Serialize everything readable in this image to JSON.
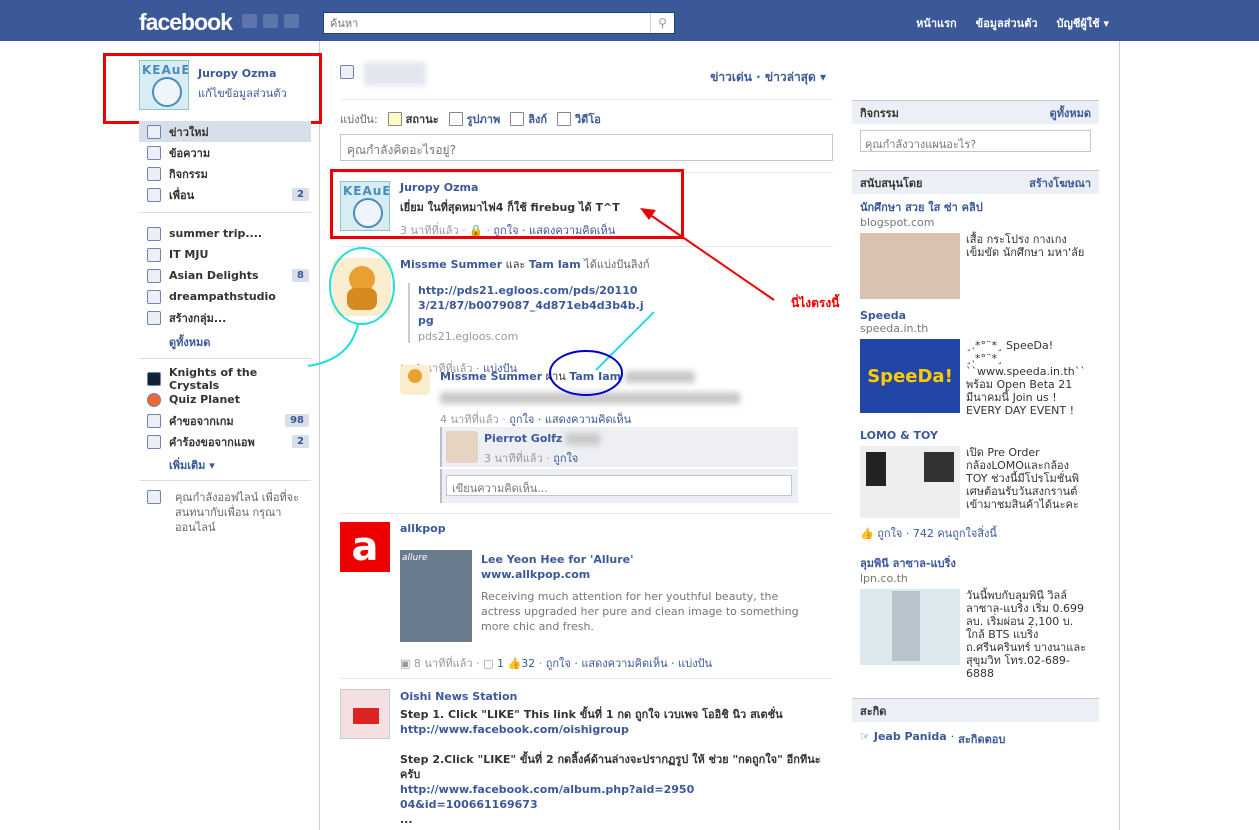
{
  "topbar": {
    "logo": "facebook",
    "search_placeholder": "ค้นหา",
    "nav": [
      "หน้าแรก",
      "ข้อมูลส่วนตัว",
      "บัญชีผู้ใช้ ▾"
    ]
  },
  "profile": {
    "name": "Juropy Ozma",
    "edit": "แก้ไขข้อมูลส่วนตัว",
    "avatar_text": "KEAuE"
  },
  "nav_main": [
    {
      "label": "ข่าวใหม่",
      "badge": "",
      "selected": true
    },
    {
      "label": "ข้อความ",
      "badge": ""
    },
    {
      "label": "กิจกรรม",
      "badge": ""
    },
    {
      "label": "เพื่อน",
      "badge": "2"
    }
  ],
  "nav_groups": [
    {
      "label": "summer trip....",
      "badge": ""
    },
    {
      "label": "IT MJU",
      "badge": ""
    },
    {
      "label": "Asian Delights",
      "badge": "8"
    },
    {
      "label": "dreampathstudio",
      "badge": ""
    },
    {
      "label": "สร้างกลุ่ม...",
      "badge": ""
    }
  ],
  "nav_groups_more": "ดูทั้งหมด",
  "nav_apps": [
    {
      "label": "Knights of the Crystals",
      "badge": ""
    },
    {
      "label": "Quiz Planet",
      "badge": ""
    },
    {
      "label": "คำขอจากเกม",
      "badge": "98"
    },
    {
      "label": "คำร้องขอจากแอพ",
      "badge": "2"
    }
  ],
  "nav_apps_more": "เพิ่มเติม ▾",
  "chat_status": "คุณกำลังออฟไลน์ เพื่อที่จะสนทนากับเพื่อน กรุณาออนไลน์",
  "feed": {
    "sort": "ข่าวเด่น · ข่าวล่าสุด ▾",
    "share_label": "แบ่งปัน:",
    "share_items": [
      "สถานะ",
      "รูปภาพ",
      "ลิงก์",
      "วิดีโอ"
    ],
    "composer_placeholder": "คุณกำลังคิดอะไรอยู่?"
  },
  "story1": {
    "author": "Juropy Ozma",
    "text": "เยี่ยม ในที่สุดหมาไฟ4 ก็ใช้ firebug ได้ T^T",
    "time": "3 นาทีที่แล้ว",
    "actions": "ถูกใจ · แสดงความคิดเห็น"
  },
  "story2": {
    "author": "Missme Summer",
    "and": "และ",
    "author2": "Tam Iam",
    "verb": "ได้แบ่งปันลิงก์",
    "link": "http://pds21.egloos.com/pds/201103/21/87/b0079087_4d871eb4d3b4b.jpg",
    "domain": "pds21.egloos.com",
    "time": "4 นาทีที่แล้ว",
    "share": "แบ่งปัน",
    "sub_author": "Missme Summer",
    "sub_via": "ผ่าน",
    "sub_via_name": "Tam Iam",
    "sub_time": "4 นาทีที่แล้ว",
    "sub_actions": "ถูกใจ · แสดงความคิดเห็น",
    "comment_author": "Pierrot Golfz",
    "comment_time": "3 นาทีที่แล้ว",
    "comment_like": "ถูกใจ",
    "comment_placeholder": "เขียนความคิดเห็น..."
  },
  "story3": {
    "author": "allkpop",
    "title": "Lee Yeon Hee for 'Allure'",
    "site": "www.allkpop.com",
    "desc": "Receiving much attention for her youthful beauty, the actress upgraded her pure and clean image to something more chic and fresh.",
    "time": "8 นาทีที่แล้ว",
    "comments": "1",
    "likes": "32",
    "actions": "ถูกใจ · แสดงความคิดเห็น · แบ่งปัน",
    "thumb_label": "allure"
  },
  "story4": {
    "author": "Oishi News Station",
    "step1": "Step 1. Click \"LIKE\" This link ขั้นที่ 1 กด ถูกใจ เวบเพจ โออิชิ นิว สเตชั่น",
    "link1": "http://www.facebook.com/oishigroup",
    "step2": "Step 2.Click \"LIKE\" ขั้นที่ 2 กดลิ้งค์ด้านล่างจะปรากฏรูป ให้ ช่วย \"กดถูกใจ\" อีกทีนะครับ",
    "link2": "http://www.facebook.com/album.php?aid=295004&id=100661169673",
    "ellipsis": "..."
  },
  "annotation": {
    "text": "นี่ไงตรงนี้",
    "color": "#ee0000"
  },
  "right": {
    "events_title": "กิจกรรม",
    "events_all": "ดูทั้งหมด",
    "events_input": "คุณกำลังวางแผนอะไร?",
    "sponsored_title": "สนับสนุนโดย",
    "create_ad": "สร้างโฆษณา",
    "ads": [
      {
        "title": "นักศึกษา สวย ใส ซ่า คลิป",
        "domain": "blogspot.com",
        "text": "เสื้อ กระโปรง กางเกง เข็มขัด นักศึกษา มหา'ลัย"
      },
      {
        "title": "Speeda",
        "domain": "speeda.in.th",
        "text": "¸.*°¨*¸ SpeeDa! ¸.*°¨*¸ ``www.speeda.in.th`` พร้อม Open Beta 21 มีนาคมนี้ Join us ! EVERY DAY EVENT !"
      },
      {
        "title": "LOMO & TOY",
        "domain": "",
        "text": "เปิด Pre Order กล้องLOMOและกล้อง TOY ช่วงนี้มีโปรโมชั่นพิเศษต้อนรับวันสงกรานต์ เข้ามาชมสินค้าได้นะคะ",
        "likes": "ถูกใจ · 742 คนถูกใจสิ่งนี้"
      },
      {
        "title": "ลุมพินี ลาซาล-แบริ่ง",
        "domain": "lpn.co.th",
        "text": "วันนี้พบกับลุมพินี วิลล์ ลาซาล-แบริ่ง เริ่ม 0.699 ลบ. เริ่มผ่อน 2,100 บ. ใกล้ BTS แบริ่ง ถ.ศรีนครินทร์ บางนาและสุขุมวิท โทร.02-689-6888"
      }
    ],
    "pokes_title": "สะกิด",
    "poke_name": "Jeab Panida",
    "poke_back": "สะกิดตอบ"
  }
}
